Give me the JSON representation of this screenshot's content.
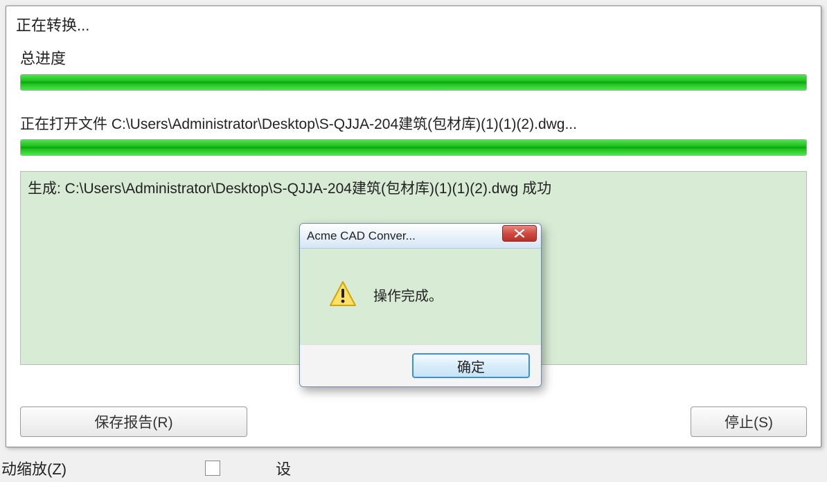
{
  "mainWindow": {
    "title": "正在转换...",
    "overallProgressLabel": "总进度",
    "fileOpeningLabel": "正在打开文件 C:\\Users\\Administrator\\Desktop\\S-QJJA-204建筑(包材库)(1)(1)(2).dwg...",
    "logMessage": "生成: C:\\Users\\Administrator\\Desktop\\S-QJJA-204建筑(包材库)(1)(1)(2).dwg 成功",
    "buttons": {
      "saveReport": "保存报告(R)",
      "stop": "停止(S)"
    }
  },
  "dialog": {
    "title": "Acme CAD Conver...",
    "message": "操作完成。",
    "okButton": "确定"
  },
  "partialBottom": {
    "leftText": "动缩放(Z)",
    "rightText": "设"
  }
}
